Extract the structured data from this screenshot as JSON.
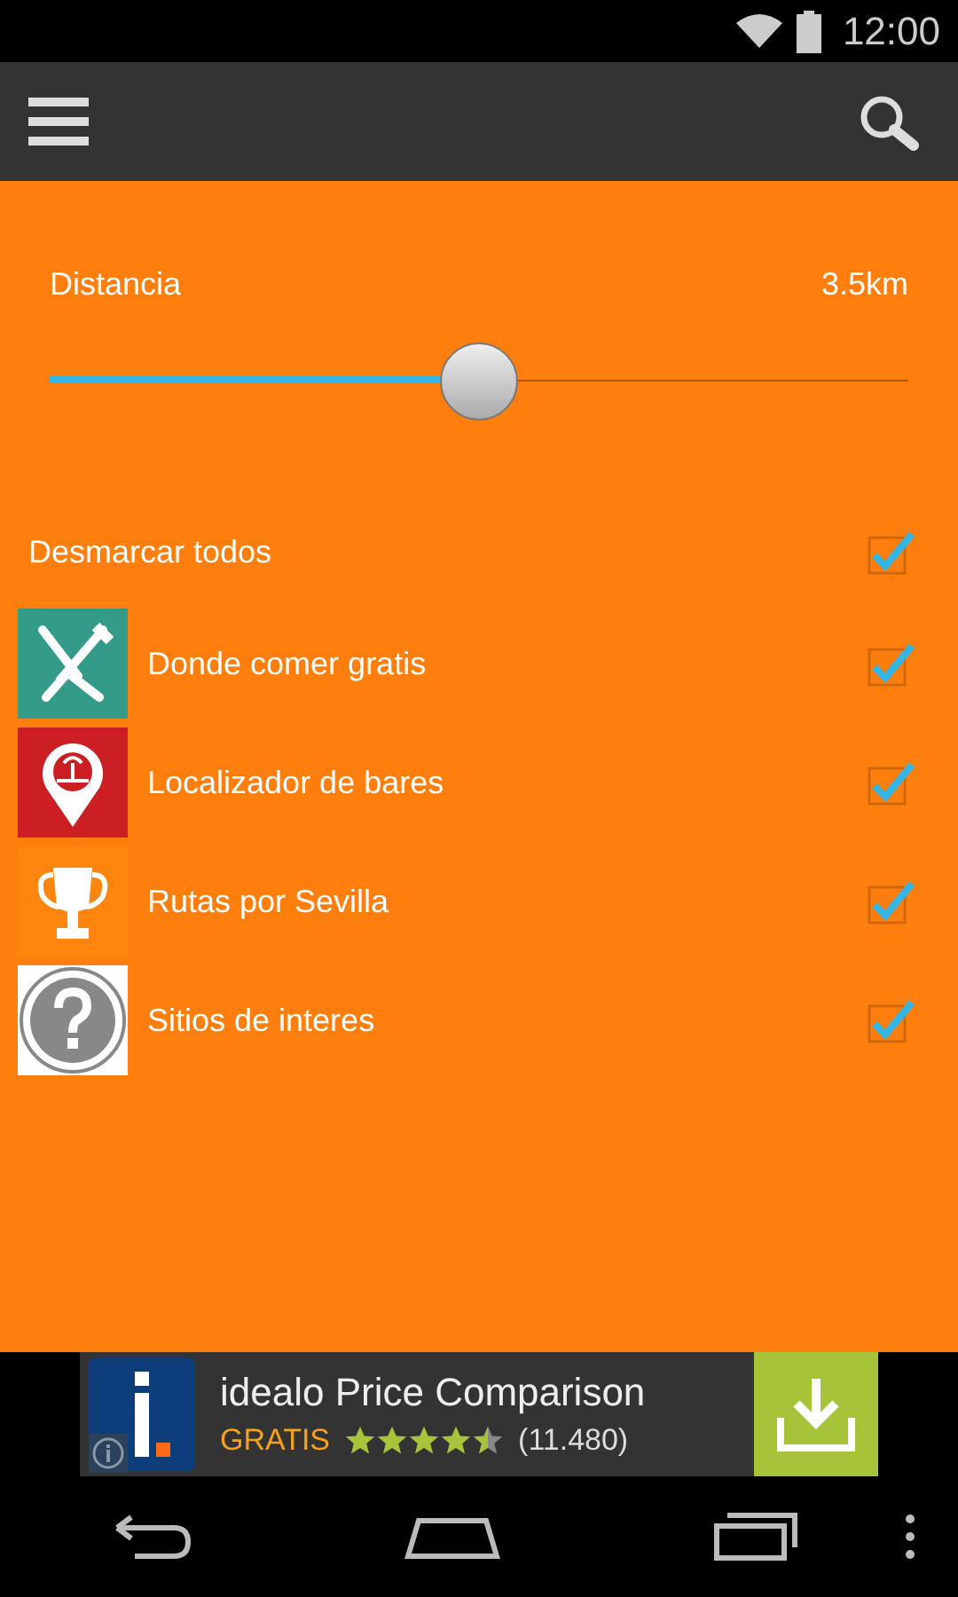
{
  "status_bar": {
    "time": "12:00"
  },
  "distance": {
    "label": "Distancia",
    "reading": "3.5km",
    "level": 0.5
  },
  "toggle_all": {
    "label": "Desmarcar todos",
    "checked": true
  },
  "categories": [
    {
      "kind": "food",
      "label": "Donde comer gratis",
      "checked": true
    },
    {
      "kind": "bars",
      "label": "Localizador de bares",
      "checked": true
    },
    {
      "kind": "routes",
      "label": "Rutas por Sevilla",
      "checked": true
    },
    {
      "kind": "sites",
      "label": "Sitios de interes",
      "checked": true
    }
  ],
  "ad": {
    "title": "idealo Price Comparison",
    "price": "GRATIS",
    "stars": 4.5,
    "reviews": "(11.480)"
  }
}
